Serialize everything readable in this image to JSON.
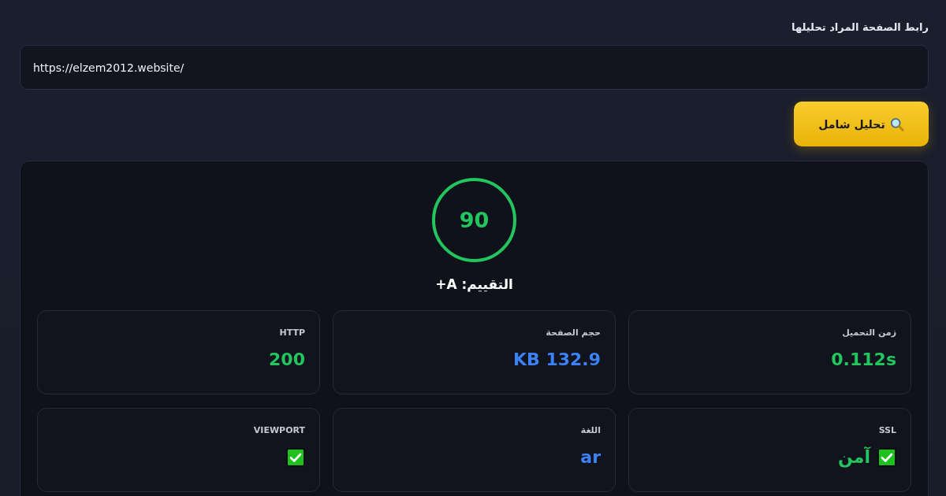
{
  "url_form": {
    "label": "رابط الصفحة المراد تحليلها",
    "url": "https://elzem2012.website/",
    "button": "تحليل شامل"
  },
  "result": {
    "score": "90",
    "grade": "التقييم: A+",
    "metrics": [
      {
        "kind": "text",
        "label": "زمن التحميل",
        "value": "0.112s",
        "color": "#22c55e"
      },
      {
        "kind": "text",
        "label": "حجم الصفحة",
        "value": "132.9 KB",
        "color": "#3b82f6"
      },
      {
        "kind": "text",
        "label": "HTTP",
        "value": "200",
        "color": "#22c55e"
      },
      {
        "kind": "check",
        "label": "SSL",
        "value": "آمن",
        "color": "#22c55e",
        "passed": true
      },
      {
        "kind": "text",
        "label": "اللغة",
        "value": "ar",
        "color": "#3b82f6"
      },
      {
        "kind": "check",
        "label": "VIEWPORT",
        "passed": true
      }
    ]
  }
}
